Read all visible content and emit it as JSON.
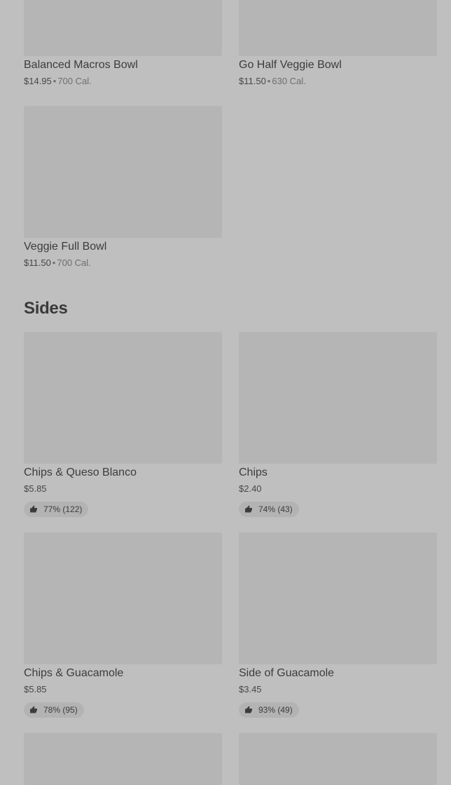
{
  "bowls": [
    {
      "name": "Balanced Macros Bowl",
      "price": "$14.95",
      "calories": "700 Cal."
    },
    {
      "name": "Go Half Veggie Bowl",
      "price": "$11.50",
      "calories": "630 Cal."
    },
    {
      "name": "Veggie Full Bowl",
      "price": "$11.50",
      "calories": "700 Cal."
    }
  ],
  "sides": {
    "title": "Sides",
    "items": [
      {
        "name": "Chips & Queso Blanco",
        "price": "$5.85",
        "rating": "77% (122)"
      },
      {
        "name": "Chips",
        "price": "$2.40",
        "rating": "74% (43)"
      },
      {
        "name": "Chips & Guacamole",
        "price": "$5.85",
        "rating": "78% (95)"
      },
      {
        "name": "Side of Guacamole",
        "price": "$3.45",
        "rating": "93% (49)"
      }
    ]
  },
  "separator": "•",
  "icons": {
    "rating": "thumbs-up-icon"
  }
}
